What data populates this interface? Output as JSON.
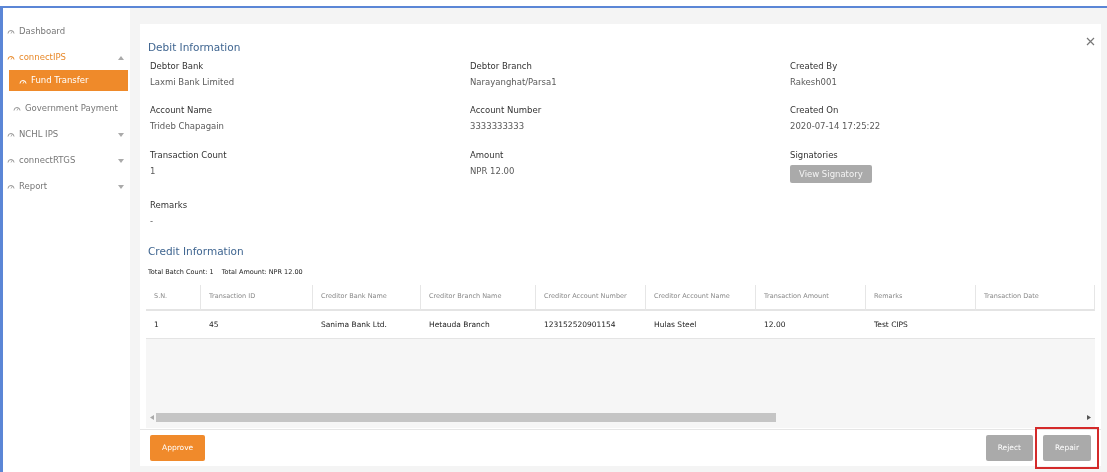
{
  "sidebar": {
    "items": [
      {
        "label": "Dashboard",
        "selected": false
      },
      {
        "label": "connectIPS",
        "expanded": true,
        "selected": false,
        "children": [
          {
            "label": "Fund Transfer",
            "selected": true
          },
          {
            "label": "Government Payment",
            "selected": false
          }
        ]
      },
      {
        "label": "NCHL IPS",
        "expanded": false,
        "selected": false
      },
      {
        "label": "connectRTGS",
        "expanded": false,
        "selected": false
      },
      {
        "label": "Report",
        "expanded": false,
        "selected": false
      }
    ]
  },
  "debit": {
    "title": "Debit Information",
    "fields": [
      {
        "label": "Debtor Bank",
        "value": "Laxmi Bank Limited"
      },
      {
        "label": "Debtor Branch",
        "value": "Narayanghat/Parsa1"
      },
      {
        "label": "Created By",
        "value": "Rakesh001"
      },
      {
        "label": "Account Name",
        "value": "Trideb Chapagain"
      },
      {
        "label": "Account Number",
        "value": "3333333333"
      },
      {
        "label": "Created On",
        "value": "2020-07-14 17:25:22"
      },
      {
        "label": "Transaction Count",
        "value": "1"
      },
      {
        "label": "Amount",
        "value": "NPR 12.00"
      },
      {
        "label": "Signatories",
        "button": "View Signatory"
      },
      {
        "label": "Remarks",
        "value": "-"
      }
    ]
  },
  "credit": {
    "title": "Credit Information",
    "summary": [
      {
        "label": "Total Batch Count:",
        "value": "1"
      },
      {
        "label": "Total Amount:",
        "value": "NPR 12.00"
      }
    ],
    "table": {
      "columns": [
        "S.N.",
        "Transaction ID",
        "Creditor Bank Name",
        "Creditor Branch Name",
        "Creditor Account Number",
        "Creditor Account Name",
        "Transaction Amount",
        "Remarks",
        "Transaction Date"
      ],
      "rows": [
        [
          "1",
          "45",
          "Sanima Bank Ltd.",
          "Hetauda Branch",
          "123152520901154",
          "Hulas Steel",
          "12.00",
          "Test CIPS",
          ""
        ]
      ]
    }
  },
  "footer": {
    "buttons": [
      {
        "label": "Approve",
        "kind": "primary",
        "highlighted": false
      },
      {
        "label": "Reject",
        "kind": "secondary",
        "highlighted": false
      },
      {
        "label": "Repair",
        "kind": "secondary",
        "highlighted": true
      }
    ]
  }
}
